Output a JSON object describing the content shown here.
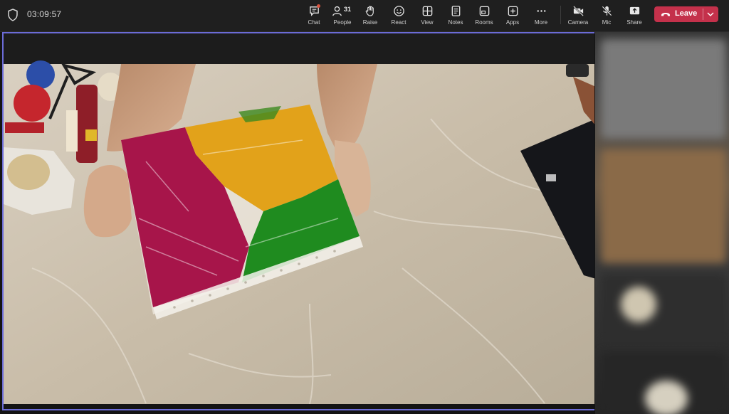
{
  "header": {
    "timer": "03:09:57",
    "toolbar": [
      {
        "id": "chat",
        "label": "Chat",
        "icon": "chat-icon"
      },
      {
        "id": "people",
        "label": "People",
        "icon": "people-icon",
        "count": "31"
      },
      {
        "id": "raise",
        "label": "Raise",
        "icon": "hand-icon"
      },
      {
        "id": "react",
        "label": "React",
        "icon": "smiley-icon"
      },
      {
        "id": "view",
        "label": "View",
        "icon": "grid-icon"
      },
      {
        "id": "notes",
        "label": "Notes",
        "icon": "notes-icon"
      },
      {
        "id": "rooms",
        "label": "Rooms",
        "icon": "rooms-icon"
      },
      {
        "id": "apps",
        "label": "Apps",
        "icon": "plus-icon"
      },
      {
        "id": "more",
        "label": "More",
        "icon": "ellipsis-icon"
      },
      {
        "id": "camera",
        "label": "Camera",
        "icon": "camera-off-icon"
      },
      {
        "id": "mic",
        "label": "Mic",
        "icon": "mic-off-icon"
      },
      {
        "id": "share",
        "label": "Share",
        "icon": "share-icon"
      }
    ],
    "leave": {
      "label": "Leave"
    }
  },
  "colors": {
    "accent": "#6b6bd6",
    "leave": "#c4314b",
    "toolbar_bg": "#1f1f1f"
  }
}
